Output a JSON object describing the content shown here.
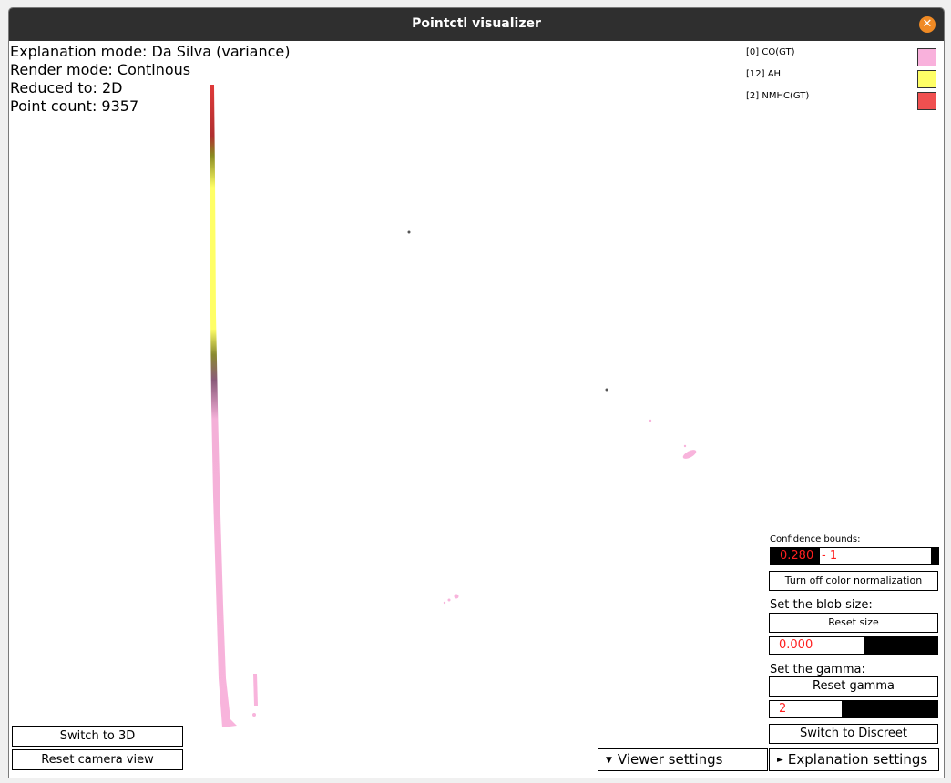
{
  "window": {
    "title": "Pointctl visualizer"
  },
  "info": {
    "explanation_mode": "Explanation mode: Da Silva (variance)",
    "render_mode": "Render mode: Continous",
    "reduced_to": "Reduced to: 2D",
    "point_count": "Point count: 9357"
  },
  "legend": [
    {
      "label": "[0] CO(GT)",
      "color": "#f9b1dc"
    },
    {
      "label": "[12] AH",
      "color": "#ffff66"
    },
    {
      "label": "[2] NMHC(GT)",
      "color": "#f05050"
    }
  ],
  "controls": {
    "confidence_label": "Confidence bounds:",
    "confidence_low": "0.280",
    "confidence_high": "- 1",
    "color_norm_button": "Turn off color normalization",
    "blob_label": "Set the blob size:",
    "reset_size_button": "Reset size",
    "blob_value": "0.000",
    "gamma_label": "Set the gamma:",
    "reset_gamma_button": "Reset gamma",
    "gamma_value": "2",
    "switch_discreet_button": "Switch to Discreet"
  },
  "bottom_left": {
    "switch_3d_button": "Switch to 3D",
    "reset_camera_button": "Reset camera view"
  },
  "bottom_tabs": {
    "viewer_settings": "Viewer settings",
    "explanation_settings": "Explanation settings"
  },
  "icons": {
    "close": "close-icon",
    "collapse_arrow": "triangle-down-icon",
    "expand_arrow": "triangle-right-icon"
  }
}
